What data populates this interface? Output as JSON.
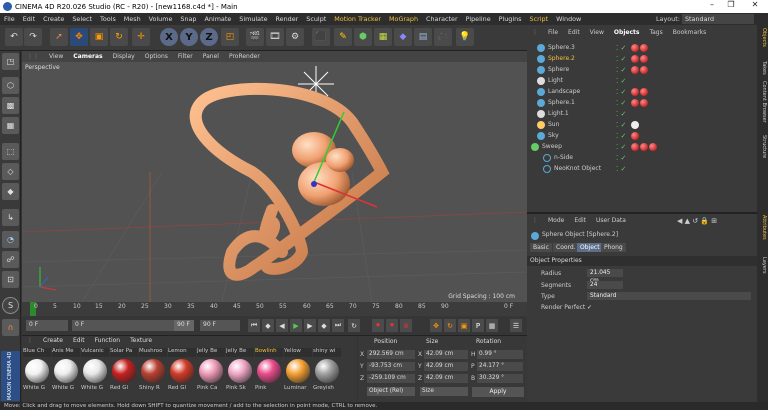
{
  "window": {
    "title": "CINEMA 4D R20.026 Studio (RC - R20) - [new1168.c4d *] - Main",
    "controls": [
      "–",
      "❐",
      "✕"
    ]
  },
  "menubar": {
    "items": [
      "File",
      "Edit",
      "Create",
      "Select",
      "Tools",
      "Mesh",
      "Volume",
      "Snap",
      "Animate",
      "Simulate",
      "Render",
      "Sculpt",
      "Motion Tracker",
      "MoGraph",
      "Character",
      "Pipeline",
      "Plugins",
      "Script",
      "Window"
    ],
    "layout_label": "Layout:",
    "layout_value": "Standard"
  },
  "toolbar": {
    "icons": [
      "undo-icon",
      "redo-icon",
      "select-icon",
      "move-icon",
      "scale-icon",
      "rotate-icon",
      "recent-icon",
      "x-axis-icon",
      "y-axis-icon",
      "z-axis-icon",
      "coord-system-icon",
      "render-view-icon",
      "render-icon",
      "render-settings-icon",
      "cube-icon",
      "pen-icon",
      "subdivision-icon",
      "array-icon",
      "deformer-icon",
      "scene-icon",
      "camera-icon",
      "light-icon"
    ],
    "axis_labels": [
      "X",
      "Y",
      "Z"
    ]
  },
  "viewport": {
    "menu": [
      "View",
      "Cameras",
      "Display",
      "Options",
      "Filter",
      "Panel",
      "ProRender"
    ],
    "label": "Perspective",
    "grid_spacing": "Grid Spacing : 100 cm"
  },
  "timeline": {
    "ticks": [
      "0",
      "5",
      "10",
      "15",
      "20",
      "25",
      "30",
      "35",
      "40",
      "45",
      "50",
      "55",
      "60",
      "65",
      "70",
      "75",
      "80",
      "85",
      "90"
    ],
    "end_label": "0 F"
  },
  "playbar": {
    "start_frame": "0 F",
    "current": "0 F",
    "end": "90 F",
    "end2": "90 F"
  },
  "materials": {
    "menu": [
      "Create",
      "Edit",
      "Function",
      "Texture"
    ],
    "row1": [
      "Blue Ch",
      "Anis Me",
      "Vulcanic",
      "Solar Pa",
      "Mushroo",
      "Lemon",
      "Jelly Be",
      "Jelly Be",
      "Bowlinh",
      "Yellow",
      "shiny wi"
    ],
    "row2": [
      "White G",
      "White G",
      "White G",
      "Red Gl",
      "Shiny R",
      "Red Gl",
      "Pink Ca",
      "Pink Sk",
      "Pink",
      "Luminar",
      "Greyish"
    ],
    "selected": "Bowlinh",
    "colors": [
      "#f2f2f2",
      "#eeeeee",
      "#e8e8e8",
      "#c82020",
      "#b84030",
      "#d23a28",
      "#ef9ab8",
      "#f0a6c6",
      "#e94b8c",
      "#f5a033",
      "#a0a0a0"
    ]
  },
  "coords": {
    "headers": [
      "Position",
      "Size",
      "Rotation"
    ],
    "axes": [
      "X",
      "Y",
      "Z"
    ],
    "rot_axes": [
      "H",
      "P",
      "B"
    ],
    "position": [
      "292.569 cm",
      "-93.753 cm",
      "-259.109 cm"
    ],
    "size": [
      "42.09 cm",
      "42.09 cm",
      "42.09 cm"
    ],
    "rotation": [
      "0.99 °",
      "24.177 °",
      "30.329 °"
    ],
    "mode": "Object (Rel)",
    "size_mode": "Size",
    "apply": "Apply"
  },
  "objects": {
    "menu": [
      "File",
      "Edit",
      "View",
      "Objects",
      "Tags",
      "Bookmarks"
    ],
    "items": [
      {
        "name": "Sphere.3",
        "selected": false
      },
      {
        "name": "Sphere.2",
        "selected": true
      },
      {
        "name": "Sphere",
        "selected": false
      },
      {
        "name": "Light",
        "selected": false
      },
      {
        "name": "Landscape",
        "selected": false
      },
      {
        "name": "Sphere.1",
        "selected": false
      },
      {
        "name": "Light.1",
        "selected": false
      },
      {
        "name": "Sun",
        "selected": false
      },
      {
        "name": "Sky",
        "selected": false
      },
      {
        "name": "Sweep",
        "selected": false
      },
      {
        "name": "n-Side",
        "selected": false
      },
      {
        "name": "NeoKnot Object",
        "selected": false
      }
    ]
  },
  "attributes": {
    "menu": [
      "Mode",
      "Edit",
      "User Data"
    ],
    "title": "Sphere Object [Sphere.2]",
    "tabs": [
      "Basic",
      "Coord.",
      "Object",
      "Phong"
    ],
    "selected_tab": "Object",
    "section": "Object Properties",
    "props": [
      {
        "label": "Radius",
        "value": "21.045 cm"
      },
      {
        "label": "Segments",
        "value": "24"
      },
      {
        "label": "Type",
        "value": "Standard"
      },
      {
        "label": "Render Perfect",
        "value": "✓"
      }
    ]
  },
  "sidetabs": [
    "Objects",
    "Takes",
    "Content Browser",
    "Structure",
    "Attributes",
    "Layers"
  ],
  "status": "Move: Click and drag to move elements. Hold down SHIFT to quantize movement / add to the selection in point mode, CTRL to remove."
}
